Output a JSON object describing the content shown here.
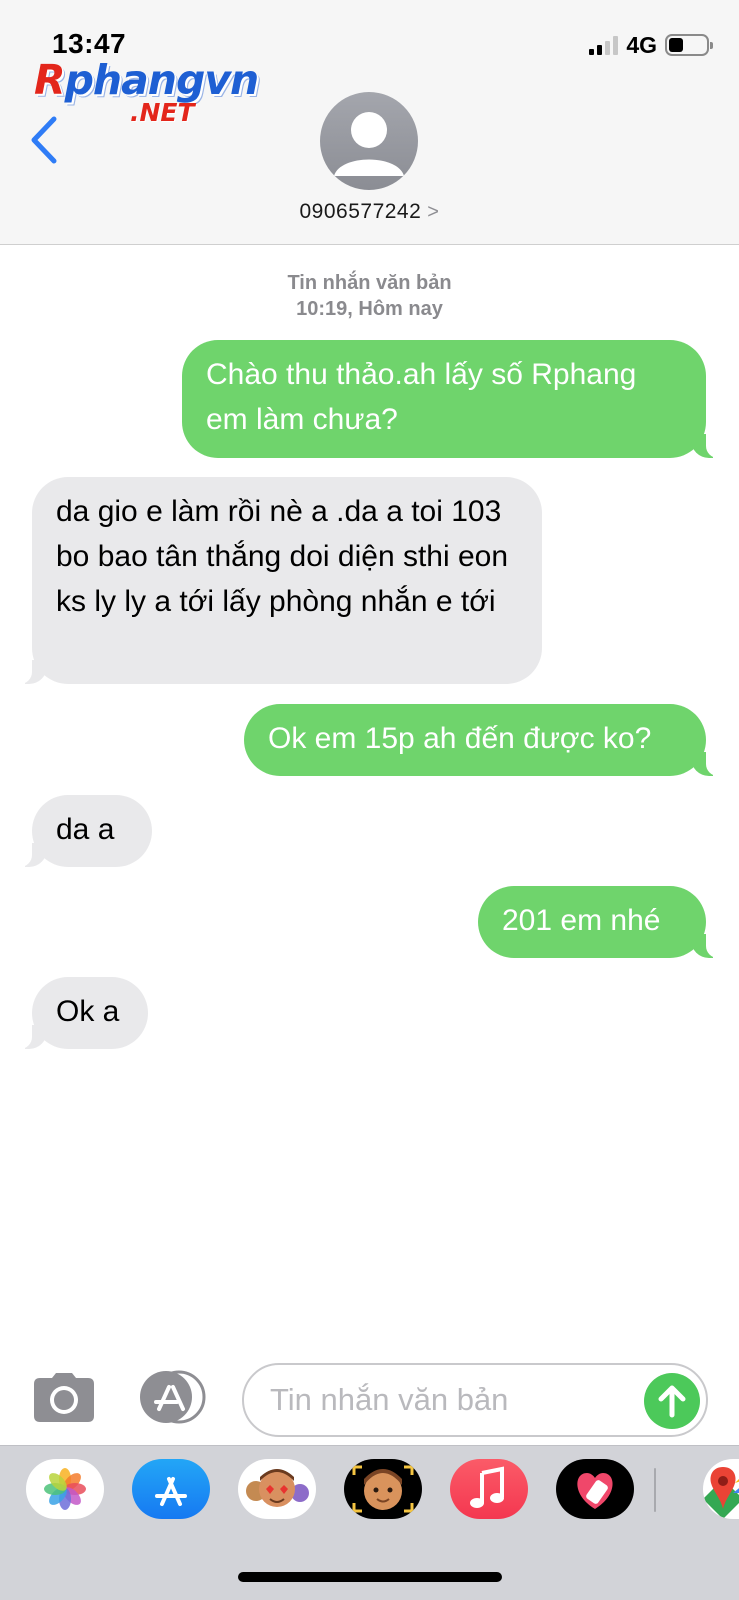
{
  "status_bar": {
    "time": "13:47",
    "network": "4G",
    "signal_bars_filled": 2,
    "signal_bars_total": 4,
    "battery_level": 0.4
  },
  "watermark": {
    "main_red": "R",
    "main_blue": "phangvn",
    "sub": ".NET"
  },
  "header": {
    "back_icon": "chevron-left-icon",
    "contact": "0906577242",
    "contact_chevron": ">"
  },
  "conversation": {
    "timestamp": {
      "label": "Tin nhắn văn bản",
      "time": "10:19, Hôm nay"
    },
    "messages": [
      {
        "direction": "outgoing",
        "text": "Chào thu thảo.ah lấy số Rphang em làm chưa?"
      },
      {
        "direction": "incoming",
        "text": "da gio e làm rồi nè a .da a toi 103 bo bao tân thắng doi diện sthi eon ks ly ly a tới lấy phòng nhắn e tới"
      },
      {
        "direction": "outgoing",
        "text": "Ok em 15p ah đến được ko?"
      },
      {
        "direction": "incoming",
        "text": "da a"
      },
      {
        "direction": "outgoing",
        "text": "201 em nhé"
      },
      {
        "direction": "incoming",
        "text": "Ok a"
      }
    ]
  },
  "compose": {
    "placeholder": "Tin nhắn văn bản",
    "camera_icon": "camera-icon",
    "appstore_icon": "app-store-icon",
    "send_icon": "arrow-up-icon"
  },
  "app_drawer": {
    "apps": [
      "photos-icon",
      "app-store-icon",
      "memoji-stickers-icon",
      "memoji-icon",
      "music-icon",
      "heart-app-icon",
      "maps-icon"
    ]
  },
  "colors": {
    "outgoing_bubble": "#6fd46c",
    "incoming_bubble": "#e9e9eb",
    "accent_blue": "#2f7cf6",
    "send_green": "#4cc95a"
  }
}
